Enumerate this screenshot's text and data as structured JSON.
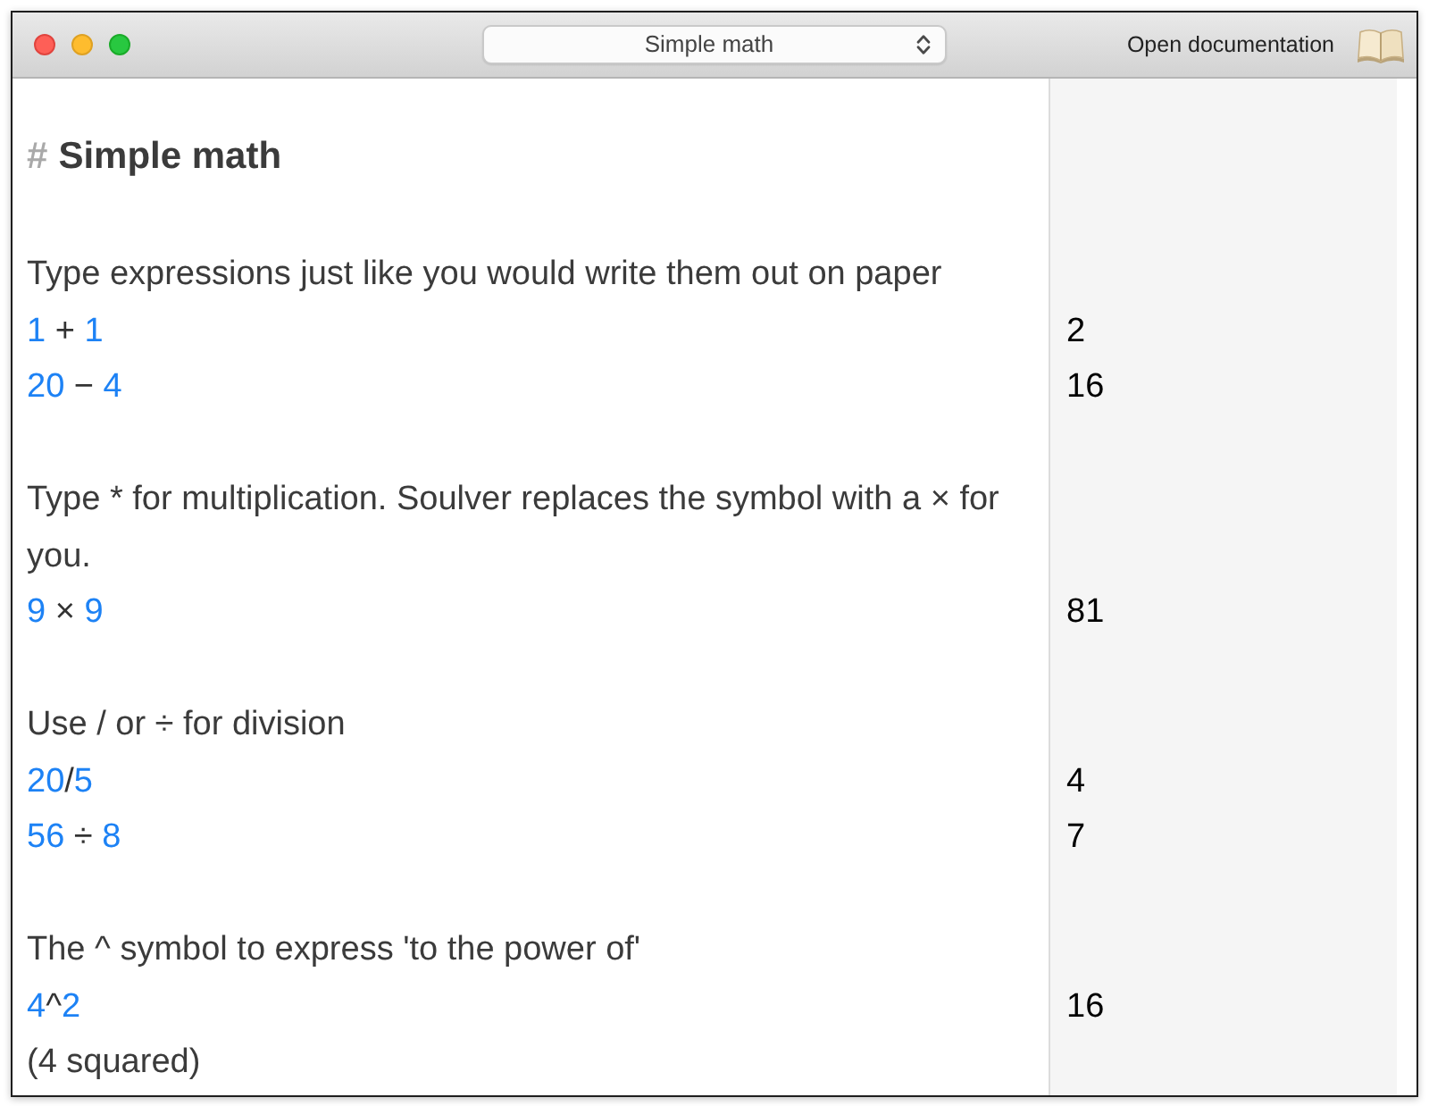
{
  "window": {
    "document_picker": {
      "value": "Simple math"
    },
    "documentation_button": "Open documentation"
  },
  "document": {
    "heading": {
      "marker": "#",
      "text": "Simple math"
    },
    "sections": [
      {
        "items": [
          {
            "kind": "comment",
            "text": "Type expressions just like you would write them out on paper"
          },
          {
            "kind": "expression",
            "tokens": [
              {
                "kind": "number",
                "text": "1"
              },
              {
                "kind": "operator",
                "text": " + "
              },
              {
                "kind": "number",
                "text": "1"
              }
            ],
            "result": "2"
          },
          {
            "kind": "expression",
            "tokens": [
              {
                "kind": "number",
                "text": "20"
              },
              {
                "kind": "operator",
                "text": " − "
              },
              {
                "kind": "number",
                "text": "4"
              }
            ],
            "result": "16"
          }
        ]
      },
      {
        "items": [
          {
            "kind": "comment",
            "text": "Type * for multiplication. Soulver replaces the symbol with a × for you."
          },
          {
            "kind": "expression",
            "tokens": [
              {
                "kind": "number",
                "text": "9"
              },
              {
                "kind": "operator",
                "text": " × "
              },
              {
                "kind": "number",
                "text": "9"
              }
            ],
            "result": "81"
          }
        ]
      },
      {
        "items": [
          {
            "kind": "comment",
            "text": "Use / or ÷ for division"
          },
          {
            "kind": "expression",
            "tokens": [
              {
                "kind": "number",
                "text": "20"
              },
              {
                "kind": "operator",
                "text": "/"
              },
              {
                "kind": "number",
                "text": "5"
              }
            ],
            "result": "4"
          },
          {
            "kind": "expression",
            "tokens": [
              {
                "kind": "number",
                "text": "56"
              },
              {
                "kind": "operator",
                "text": " ÷ "
              },
              {
                "kind": "number",
                "text": "8"
              }
            ],
            "result": "7"
          }
        ]
      },
      {
        "items": [
          {
            "kind": "comment",
            "text": "The ^ symbol to express 'to the power of'"
          },
          {
            "kind": "expression",
            "tokens": [
              {
                "kind": "number",
                "text": "4"
              },
              {
                "kind": "operator",
                "text": "^"
              },
              {
                "kind": "number",
                "text": "2"
              }
            ],
            "result": "16"
          },
          {
            "kind": "comment",
            "text": "(4 squared)"
          }
        ]
      }
    ]
  }
}
